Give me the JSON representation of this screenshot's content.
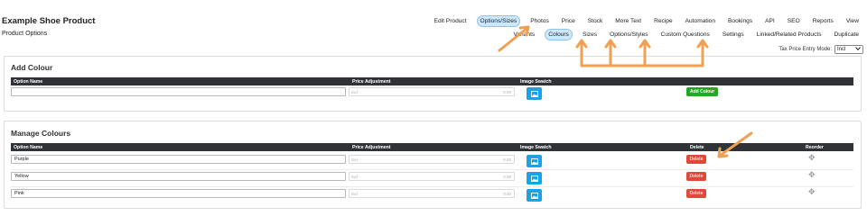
{
  "header": {
    "title": "Example Shoe Product",
    "subtitle": "Product Options"
  },
  "top_nav": [
    {
      "label": "Edit Product",
      "active": false
    },
    {
      "label": "Options/Sizes",
      "active": true
    },
    {
      "label": "Photos",
      "active": false
    },
    {
      "label": "Price",
      "active": false
    },
    {
      "label": "Stock",
      "active": false
    },
    {
      "label": "More Text",
      "active": false
    },
    {
      "label": "Recipe",
      "active": false
    },
    {
      "label": "Automation",
      "active": false
    },
    {
      "label": "Bookings",
      "active": false
    },
    {
      "label": "API",
      "active": false
    },
    {
      "label": "SEO",
      "active": false
    },
    {
      "label": "Reports",
      "active": false
    },
    {
      "label": "View",
      "active": false
    }
  ],
  "sub_nav": [
    {
      "label": "Variants",
      "active": false
    },
    {
      "label": "Colours",
      "active": true
    },
    {
      "label": "Sizes",
      "active": false
    },
    {
      "label": "Options/Styles",
      "active": false
    },
    {
      "label": "Custom Questions",
      "active": false
    },
    {
      "label": "Settings",
      "active": false
    },
    {
      "label": "Linked/Related Products",
      "active": false
    },
    {
      "label": "Duplicate",
      "active": false
    }
  ],
  "tax": {
    "label": "Tax Price Entry Mode:",
    "selected": "Incl"
  },
  "add_colour": {
    "title": "Add Colour",
    "columns": {
      "option_name": "Option Name",
      "price_adjustment": "Price Adjustment",
      "image_swatch": "Image Swatch"
    },
    "option_name_value": "",
    "price_prefix": "incl",
    "price_value": "0.00",
    "add_button": "Add Colour"
  },
  "manage_colours": {
    "title": "Manage Colours",
    "columns": {
      "option_name": "Option Name",
      "price_adjustment": "Price Adjustment",
      "image_swatch": "Image Swatch",
      "delete": "Delete",
      "reorder": "Reorder"
    },
    "rows": [
      {
        "name": "Purple",
        "price_prefix": "incl",
        "price": "0.00",
        "delete_label": "Delete"
      },
      {
        "name": "Yellow",
        "price_prefix": "incl",
        "price": "0.00",
        "delete_label": "Delete"
      },
      {
        "name": "Pink",
        "price_prefix": "incl",
        "price": "0.00",
        "delete_label": "Delete"
      }
    ]
  },
  "colors": {
    "annotation_arrow": "#f0a050",
    "active_tab_bg": "#cfe7f8",
    "table_header": "#2f3338",
    "swatch_button": "#1aa3e8",
    "add_button": "#22a822",
    "delete_button": "#e0483a"
  },
  "icons": {
    "swatch": "image-icon",
    "reorder": "move-icon",
    "select": "chevron-down-icon"
  }
}
